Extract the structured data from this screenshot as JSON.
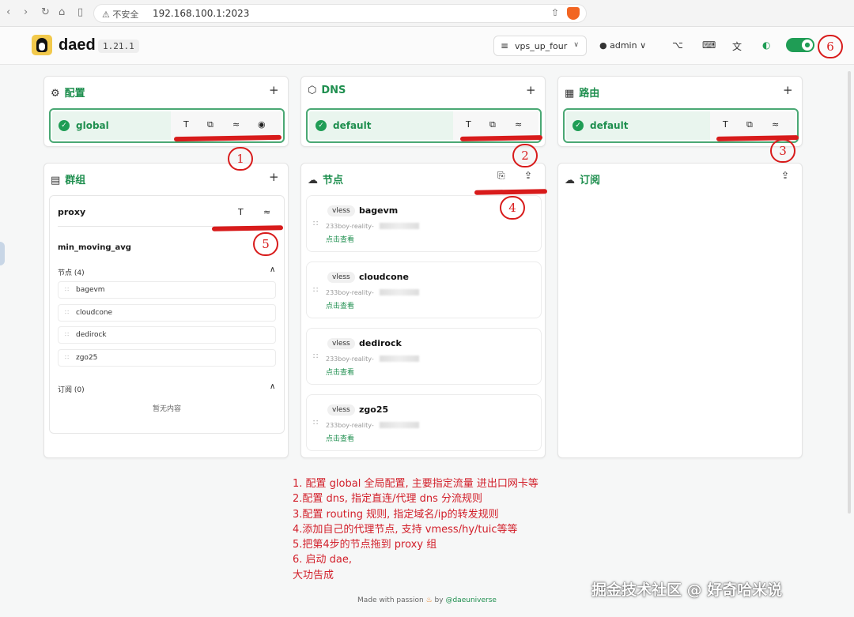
{
  "browser": {
    "security": "不安全",
    "url": "192.168.100.1:2023"
  },
  "header": {
    "brand": "daed",
    "version": "1.21.1",
    "profile_select": "vps_up_four",
    "user": "admin"
  },
  "config": {
    "title": "配置",
    "item": "global"
  },
  "dns": {
    "title": "DNS",
    "item": "default"
  },
  "routing": {
    "title": "路由",
    "item": "default"
  },
  "groups": {
    "title": "群组",
    "group_name": "proxy",
    "policy": "min_moving_avg",
    "nodes_label": "节点 (4)",
    "members": [
      "bagevm",
      "cloudcone",
      "dedirock",
      "zgo25"
    ],
    "subs_label": "订阅 (0)",
    "empty": "暂无内容"
  },
  "nodes": {
    "title": "节点",
    "items": [
      {
        "tag": "vless",
        "name": "bagevm",
        "sub": "233boy-reality-",
        "link": "点击查看"
      },
      {
        "tag": "vless",
        "name": "cloudcone",
        "sub": "233boy-reality-",
        "link": "点击查看"
      },
      {
        "tag": "vless",
        "name": "dedirock",
        "sub": "233boy-reality-",
        "link": "点击查看"
      },
      {
        "tag": "vless",
        "name": "zgo25",
        "sub": "233boy-reality-",
        "link": "点击查看"
      }
    ]
  },
  "subscriptions": {
    "title": "订阅"
  },
  "annotations": {
    "markers": [
      "1",
      "2",
      "3",
      "4",
      "5",
      "6"
    ],
    "notes": [
      "1. 配置 global 全局配置, 主要指定流量 进出口网卡等",
      "2.配置 dns, 指定直连/代理 dns 分流规则",
      "3.配置 routing 规则, 指定域名/ip的转发规则",
      "4.添加自己的代理节点, 支持 vmess/hy/tuic等等",
      "5.把第4步的节点拖到 proxy 组",
      "6. 启动 dae,",
      "大功告成"
    ]
  },
  "footer": {
    "prefix": "Made with passion",
    "by": "by",
    "handle": "@daeuniverse"
  },
  "watermark": "掘金技术社区 @ 好奇哈米说",
  "colors": {
    "accent": "#1f8f4f",
    "toggle": "#1f9d55",
    "annotation": "#d81b1b"
  }
}
